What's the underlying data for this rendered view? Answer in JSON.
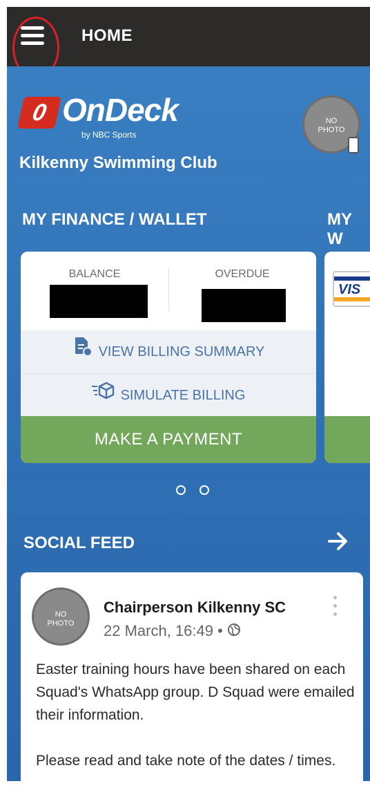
{
  "header": {
    "title": "HOME",
    "menu_icon": "hamburger-menu-icon",
    "highlight_color": "#d82027"
  },
  "brand": {
    "logo_badge": "0",
    "logo_text": "OnDeck",
    "logo_sub": "by NBC Sports"
  },
  "club": {
    "name": "Kilkenny Swimming Club"
  },
  "profile": {
    "avatar_text_1": "NO",
    "avatar_text_2": "PHOTO"
  },
  "finance": {
    "section_title": "MY FINANCE / WALLET",
    "next_section_peek": "MY W",
    "balance_label": "BALANCE",
    "overdue_label": "OVERDUE",
    "view_billing_label": "VIEW BILLING SUMMARY",
    "simulate_billing_label": "SIMULATE BILLING",
    "make_payment_label": "MAKE A PAYMENT",
    "card_brand_text": "VIS",
    "accent_color": "#73a85c"
  },
  "pagination": {
    "pages": 2,
    "active_index": 0
  },
  "social": {
    "section_title": "SOCIAL FEED",
    "post": {
      "author": "Chairperson Kilkenny SC",
      "timestamp": "22 March, 16:49 •",
      "avatar_text_1": "NO",
      "avatar_text_2": "PHOTO",
      "paragraph_1": "Easter training hours have been shared on each Squad's WhatsApp group.  D Squad were emailed their information.",
      "paragraph_2": "Please read and take note of the dates / times."
    }
  }
}
